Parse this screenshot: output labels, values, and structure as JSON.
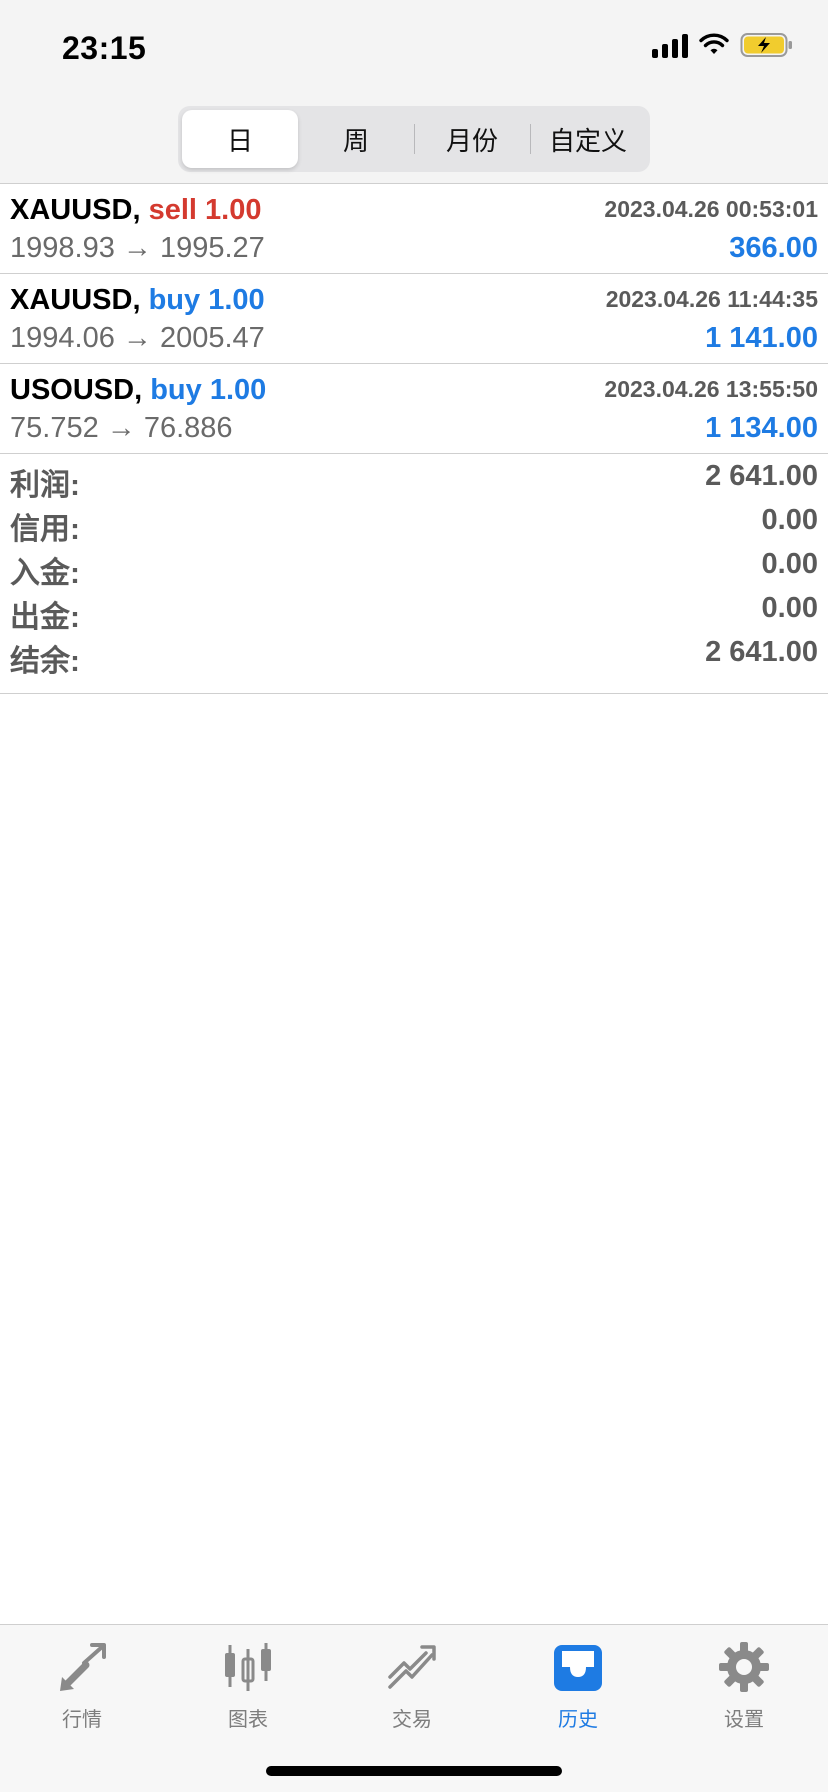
{
  "status_bar": {
    "time": "23:15"
  },
  "period_tabs": [
    {
      "label": "日",
      "active": true
    },
    {
      "label": "周",
      "active": false
    },
    {
      "label": "月份",
      "active": false
    },
    {
      "label": "自定义",
      "active": false
    }
  ],
  "deals": [
    {
      "symbol": "XAUUSD,",
      "action": "sell 1.00",
      "side": "sell",
      "date": "2023.04.26 00:53:01",
      "prices": "1998.93 → 1995.27",
      "profit": "366.00"
    },
    {
      "symbol": "XAUUSD,",
      "action": "buy 1.00",
      "side": "buy",
      "date": "2023.04.26 11:44:35",
      "prices": "1994.06 → 2005.47",
      "profit": "1 141.00"
    },
    {
      "symbol": "USOUSD,",
      "action": "buy 1.00",
      "side": "buy",
      "date": "2023.04.26 13:55:50",
      "prices": "75.752 → 76.886",
      "profit": "1 134.00"
    }
  ],
  "summary": [
    {
      "label": "利润:",
      "value": "2 641.00"
    },
    {
      "label": "信用:",
      "value": "0.00"
    },
    {
      "label": "入金:",
      "value": "0.00"
    },
    {
      "label": "出金:",
      "value": "0.00"
    },
    {
      "label": "结余:",
      "value": "2 641.00"
    }
  ],
  "tabbar": [
    {
      "label": "行情",
      "icon": "quotes-arrows-icon",
      "active": false
    },
    {
      "label": "图表",
      "icon": "candlestick-chart-icon",
      "active": false
    },
    {
      "label": "交易",
      "icon": "trade-trend-icon",
      "active": false
    },
    {
      "label": "历史",
      "icon": "history-inbox-icon",
      "active": true
    },
    {
      "label": "设置",
      "icon": "gear-icon",
      "active": false
    }
  ],
  "colors": {
    "sell": "#d43a2f",
    "buy": "#1e7be3",
    "active_tab": "#1e7be3",
    "inactive_tab": "#7d7d7d"
  }
}
